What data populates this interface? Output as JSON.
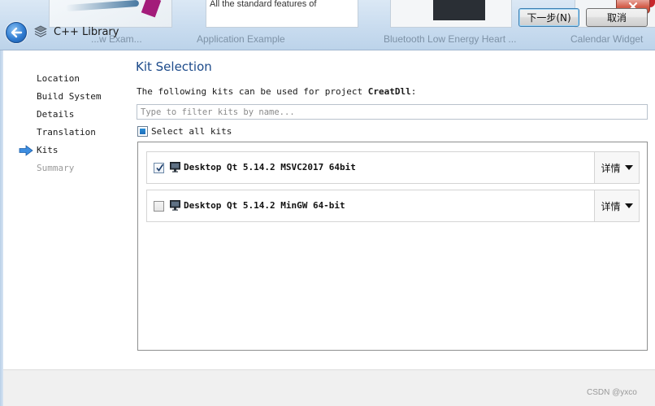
{
  "background_windows": [
    {
      "label": "...w Exam..."
    },
    {
      "label": "Application Example",
      "snippet": "All the standard features of"
    },
    {
      "label": "Bluetooth Low Energy Heart ..."
    },
    {
      "label": "Calendar Widget"
    }
  ],
  "titlebar": {
    "title": "C++ Library",
    "back_icon": "back-arrow-icon",
    "wizard_icon": "stacked-layers-icon"
  },
  "sidebar": {
    "steps": [
      {
        "label": "Location",
        "state": "done"
      },
      {
        "label": "Build System",
        "state": "done"
      },
      {
        "label": "Details",
        "state": "done"
      },
      {
        "label": "Translation",
        "state": "done"
      },
      {
        "label": "Kits",
        "state": "current"
      },
      {
        "label": "Summary",
        "state": "pending"
      }
    ]
  },
  "main": {
    "title": "Kit Selection",
    "intro_prefix": "The following kits can be used for project ",
    "project_name": "CreatDll",
    "intro_suffix": ":",
    "filter_placeholder": "Type to filter kits by name...",
    "select_all_label": "Select all kits",
    "kits": [
      {
        "name": "Desktop Qt 5.14.2 MSVC2017 64bit",
        "checked": true,
        "details_label": "详情"
      },
      {
        "name": "Desktop Qt 5.14.2 MinGW 64-bit",
        "checked": false,
        "details_label": "详情"
      }
    ]
  },
  "buttons": {
    "next_label": "下一步(N)",
    "cancel_label": "取消"
  },
  "watermark": "CSDN @yxco",
  "colors": {
    "title_blue": "#1c4a8a",
    "default_button_border": "#3c7fb1",
    "checkbox_fill": "#1e6db8"
  }
}
